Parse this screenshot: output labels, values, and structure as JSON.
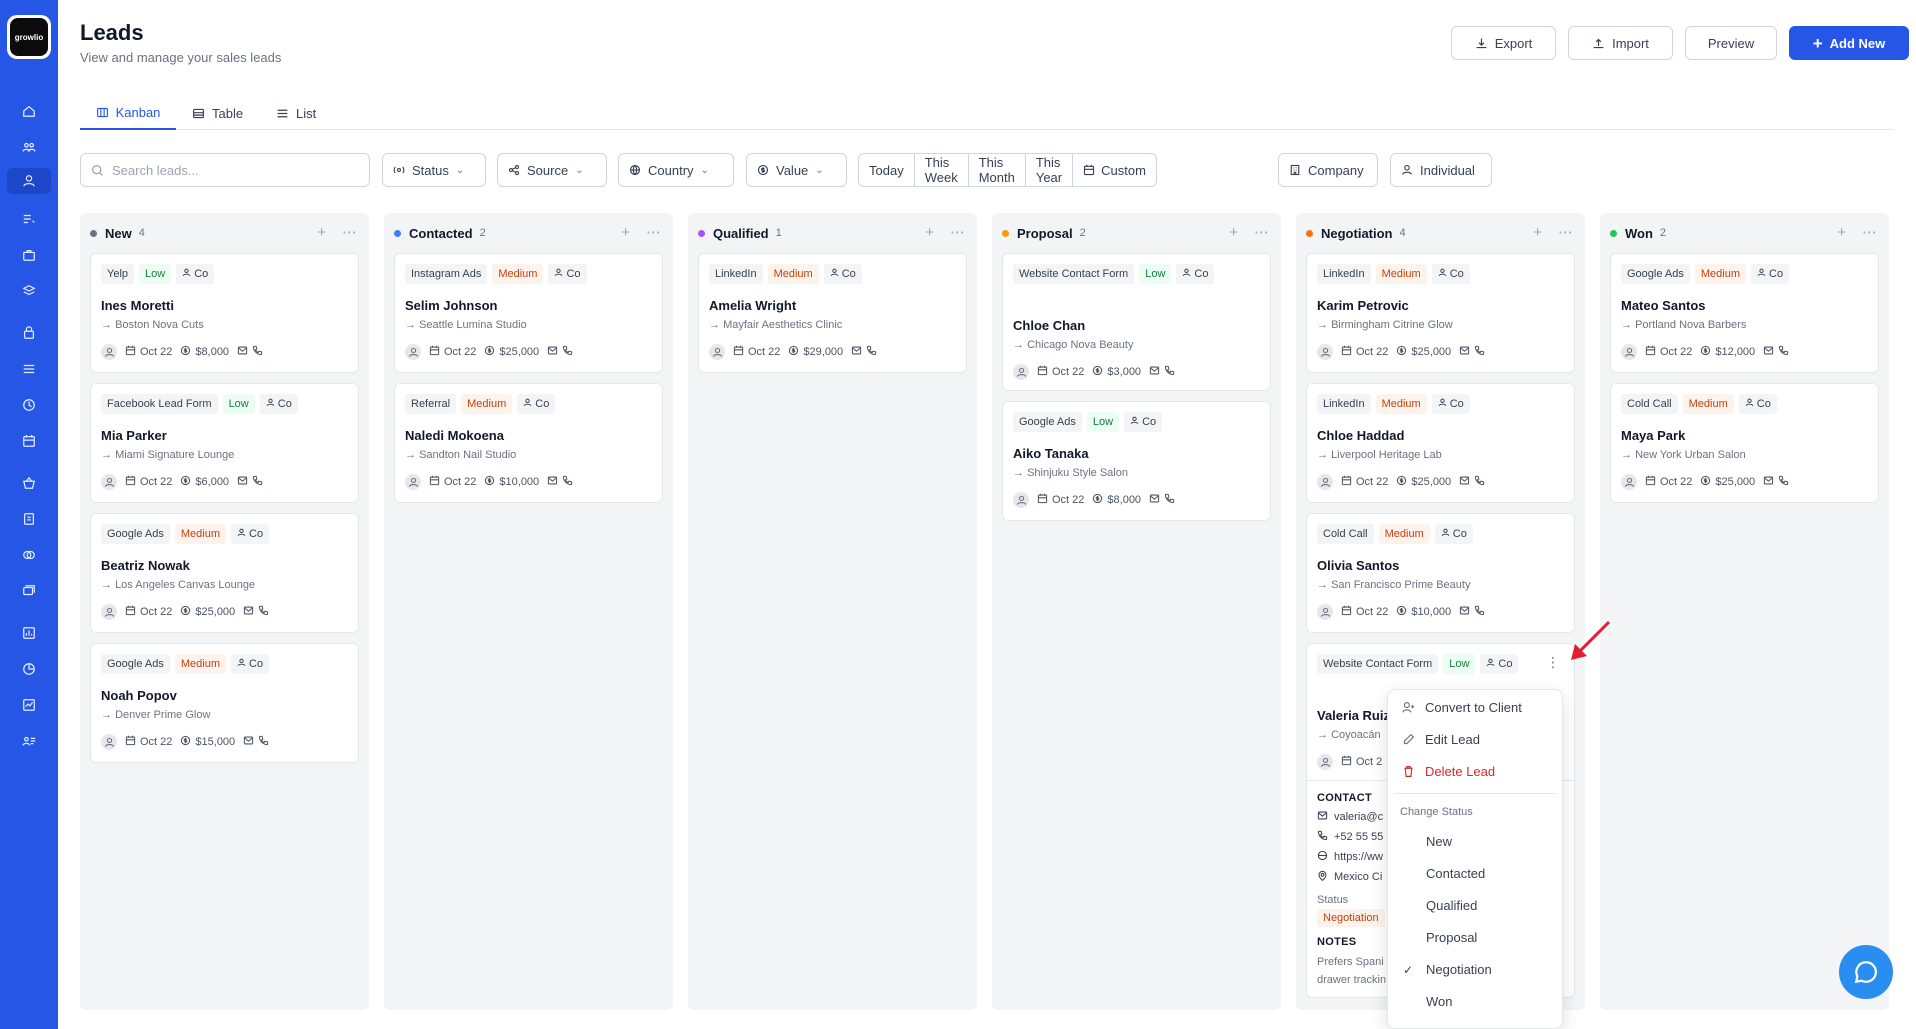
{
  "app": {
    "logo_text": "growlio"
  },
  "header": {
    "title": "Leads",
    "subtitle": "View and manage your sales leads",
    "export_label": "Export",
    "import_label": "Import",
    "preview_label": "Preview",
    "add_new_label": "Add New"
  },
  "tabs": {
    "kanban": "Kanban",
    "table": "Table",
    "list": "List"
  },
  "filters": {
    "search_placeholder": "Search leads...",
    "status": "Status",
    "source": "Source",
    "country": "Country",
    "value": "Value",
    "today": "Today",
    "this_week": "This Week",
    "this_month": "This Month",
    "this_year": "This Year",
    "custom": "Custom",
    "company": "Company",
    "individual": "Individual"
  },
  "colors": {
    "brand": "#2556e6",
    "new": "#6b7280",
    "contacted": "#3b82f6",
    "qualified": "#a855f7",
    "proposal": "#f59e0b",
    "negotiation": "#f97316",
    "won": "#22c55e"
  },
  "columns": {
    "new": {
      "name": "New",
      "count": "4"
    },
    "contacted": {
      "name": "Contacted",
      "count": "2"
    },
    "qualified": {
      "name": "Qualified",
      "count": "1"
    },
    "proposal": {
      "name": "Proposal",
      "count": "2"
    },
    "negotiation": {
      "name": "Negotiation",
      "count": "4"
    },
    "won": {
      "name": "Won",
      "count": "2"
    }
  },
  "cards": {
    "c1": {
      "source": "Yelp",
      "priority": "Low",
      "type": "Co",
      "name": "Ines Moretti",
      "company": "Boston Nova Cuts",
      "date": "Oct 22",
      "value": "$8,000"
    },
    "c2": {
      "source": "Facebook Lead Form",
      "priority": "Low",
      "type": "Co",
      "name": "Mia Parker",
      "company": "Miami Signature Lounge",
      "date": "Oct 22",
      "value": "$6,000"
    },
    "c3": {
      "source": "Google Ads",
      "priority": "Medium",
      "type": "Co",
      "name": "Beatriz Nowak",
      "company": "Los Angeles Canvas Lounge",
      "date": "Oct 22",
      "value": "$25,000"
    },
    "c4": {
      "source": "Google Ads",
      "priority": "Medium",
      "type": "Co",
      "name": "Noah Popov",
      "company": "Denver Prime Glow",
      "date": "Oct 22",
      "value": "$15,000"
    },
    "c5": {
      "source": "Instagram Ads",
      "priority": "Medium",
      "type": "Co",
      "name": "Selim Johnson",
      "company": "Seattle Lumina Studio",
      "date": "Oct 22",
      "value": "$25,000"
    },
    "c6": {
      "source": "Referral",
      "priority": "Medium",
      "type": "Co",
      "name": "Naledi Mokoena",
      "company": "Sandton Nail Studio",
      "date": "Oct 22",
      "value": "$10,000"
    },
    "c7": {
      "source": "LinkedIn",
      "priority": "Medium",
      "type": "Co",
      "name": "Amelia Wright",
      "company": "Mayfair Aesthetics Clinic",
      "date": "Oct 22",
      "value": "$29,000"
    },
    "c8": {
      "source": "Website Contact Form",
      "priority": "Low",
      "type": "Co",
      "name": "Chloe Chan",
      "company": "Chicago Nova Beauty",
      "date": "Oct 22",
      "value": "$3,000"
    },
    "c9": {
      "source": "Google Ads",
      "priority": "Low",
      "type": "Co",
      "name": "Aiko Tanaka",
      "company": "Shinjuku Style Salon",
      "date": "Oct 22",
      "value": "$8,000"
    },
    "c10": {
      "source": "LinkedIn",
      "priority": "Medium",
      "type": "Co",
      "name": "Karim Petrovic",
      "company": "Birmingham Citrine Glow",
      "date": "Oct 22",
      "value": "$25,000"
    },
    "c11": {
      "source": "LinkedIn",
      "priority": "Medium",
      "type": "Co",
      "name": "Chloe Haddad",
      "company": "Liverpool Heritage Lab",
      "date": "Oct 22",
      "value": "$25,000"
    },
    "c12": {
      "source": "Cold Call",
      "priority": "Medium",
      "type": "Co",
      "name": "Olivia Santos",
      "company": "San Francisco Prime Beauty",
      "date": "Oct 22",
      "value": "$10,000"
    },
    "c13": {
      "source": "Website Contact Form",
      "priority": "Low",
      "type": "Co",
      "name": "Valeria Ruiz",
      "company": "Coyoacán",
      "date": "Oct 2"
    },
    "c14": {
      "source": "Google Ads",
      "priority": "Medium",
      "type": "Co",
      "name": "Mateo Santos",
      "company": "Portland Nova Barbers",
      "date": "Oct 22",
      "value": "$12,000"
    },
    "c15": {
      "source": "Cold Call",
      "priority": "Medium",
      "type": "Co",
      "name": "Maya Park",
      "company": "New York Urban Salon",
      "date": "Oct 22",
      "value": "$25,000"
    }
  },
  "expanded": {
    "contact_label": "CONTACT",
    "email": "valeria@c",
    "phone": "+52 55 55",
    "website": "https://ww",
    "location": "Mexico Ci",
    "status_label": "Status",
    "status_value": "Negotiation",
    "notes_label": "NOTES",
    "notes_line1": "Prefers Spani",
    "notes_line2": "drawer trackin"
  },
  "menu": {
    "convert": "Convert to Client",
    "edit": "Edit Lead",
    "delete": "Delete Lead",
    "change_status_label": "Change Status",
    "statuses": [
      "New",
      "Contacted",
      "Qualified",
      "Proposal",
      "Negotiation",
      "Won"
    ],
    "selected": "Negotiation"
  }
}
